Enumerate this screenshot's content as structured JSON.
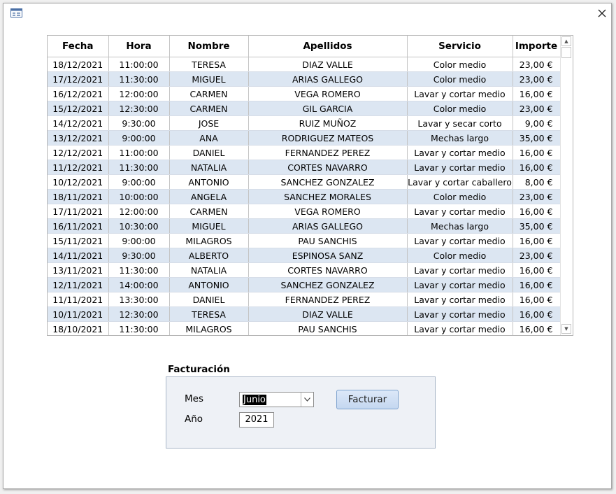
{
  "columns": [
    "Fecha",
    "Hora",
    "Nombre",
    "Apellidos",
    "Servicio",
    "Importe"
  ],
  "rows": [
    [
      "18/12/2021",
      "11:00:00",
      "TERESA",
      "DIAZ VALLE",
      "Color medio",
      "23,00 €"
    ],
    [
      "17/12/2021",
      "11:30:00",
      "MIGUEL",
      "ARIAS GALLEGO",
      "Color medio",
      "23,00 €"
    ],
    [
      "16/12/2021",
      "12:00:00",
      "CARMEN",
      "VEGA ROMERO",
      "Lavar y cortar medio",
      "16,00 €"
    ],
    [
      "15/12/2021",
      "12:30:00",
      "CARMEN",
      "GIL GARCIA",
      "Color medio",
      "23,00 €"
    ],
    [
      "14/12/2021",
      "9:30:00",
      "JOSE",
      "RUIZ MUÑOZ",
      "Lavar y secar corto",
      "9,00 €"
    ],
    [
      "13/12/2021",
      "9:00:00",
      "ANA",
      "RODRIGUEZ MATEOS",
      "Mechas largo",
      "35,00 €"
    ],
    [
      "12/12/2021",
      "11:00:00",
      "DANIEL",
      "FERNANDEZ PEREZ",
      "Lavar y cortar medio",
      "16,00 €"
    ],
    [
      "11/12/2021",
      "11:30:00",
      "NATALIA",
      "CORTES NAVARRO",
      "Lavar y cortar medio",
      "16,00 €"
    ],
    [
      "10/12/2021",
      "9:00:00",
      "ANTONIO",
      "SANCHEZ GONZALEZ",
      "Lavar y cortar caballero",
      "8,00 €"
    ],
    [
      "18/11/2021",
      "10:00:00",
      "ANGELA",
      "SANCHEZ MORALES",
      "Color medio",
      "23,00 €"
    ],
    [
      "17/11/2021",
      "12:00:00",
      "CARMEN",
      "VEGA ROMERO",
      "Lavar y cortar medio",
      "16,00 €"
    ],
    [
      "16/11/2021",
      "10:30:00",
      "MIGUEL",
      "ARIAS GALLEGO",
      "Mechas largo",
      "35,00 €"
    ],
    [
      "15/11/2021",
      "9:00:00",
      "MILAGROS",
      "PAU SANCHIS",
      "Lavar y cortar medio",
      "16,00 €"
    ],
    [
      "14/11/2021",
      "9:30:00",
      "ALBERTO",
      "ESPINOSA SANZ",
      "Color medio",
      "23,00 €"
    ],
    [
      "13/11/2021",
      "11:30:00",
      "NATALIA",
      "CORTES NAVARRO",
      "Lavar y cortar medio",
      "16,00 €"
    ],
    [
      "12/11/2021",
      "14:00:00",
      "ANTONIO",
      "SANCHEZ GONZALEZ",
      "Lavar y cortar medio",
      "16,00 €"
    ],
    [
      "11/11/2021",
      "13:30:00",
      "DANIEL",
      "FERNANDEZ PEREZ",
      "Lavar y cortar medio",
      "16,00 €"
    ],
    [
      "10/11/2021",
      "12:30:00",
      "TERESA",
      "DIAZ VALLE",
      "Lavar y cortar medio",
      "16,00 €"
    ],
    [
      "18/10/2021",
      "11:30:00",
      "MILAGROS",
      "PAU SANCHIS",
      "Lavar y cortar medio",
      "16,00 €"
    ]
  ],
  "billing": {
    "title": "Facturación",
    "month_label": "Mes",
    "month_value": "Junio",
    "year_label": "Año",
    "year_value": "2021",
    "button_label": "Facturar"
  },
  "icons": {
    "form": "form-icon",
    "close": "close-icon",
    "scroll_up": "scroll-up-icon",
    "scroll_down": "scroll-down-icon",
    "dropdown": "chevron-down-icon"
  },
  "colors": {
    "alt_row": "#dce6f2",
    "button": "#c4d7f0",
    "selection": "#000000"
  }
}
